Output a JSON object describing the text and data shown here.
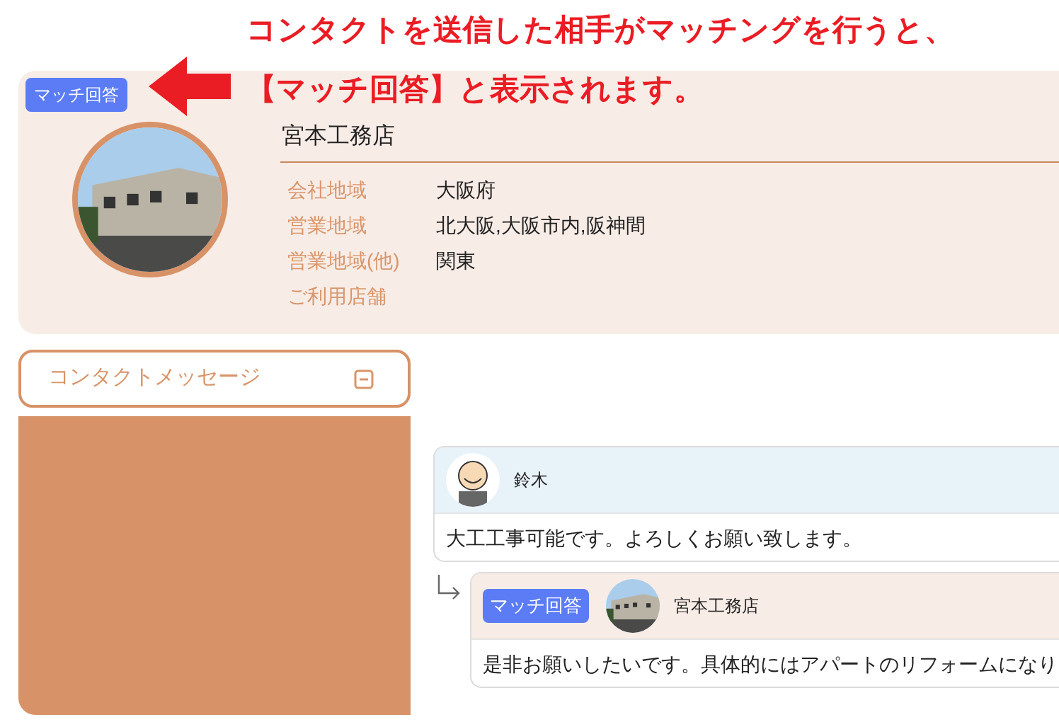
{
  "annotation": {
    "lines": [
      "コンタクトを送信した相手がマッチングを行うと、",
      "【マッチ回答】と表示されます。"
    ]
  },
  "profile": {
    "badge": "マッチ回答",
    "name": "宮本工務店",
    "fields": [
      {
        "label": "会社地域",
        "value": "大阪府"
      },
      {
        "label": "営業地域",
        "value": "北大阪,大阪市内,阪神間"
      },
      {
        "label": "営業地域(他)",
        "value": "関東"
      },
      {
        "label": "ご利用店舗"
      }
    ]
  },
  "contact_button": {
    "label": "コンタクトメッセージ"
  },
  "messages": [
    {
      "kind": "message",
      "sender": "鈴木",
      "text": "大工工事可能です。よろしくお願い致します。"
    },
    {
      "kind": "reply",
      "badge": "マッチ回答",
      "sender": "宮本工務店",
      "text": "是非お願いしたいです。具体的にはアパートのリフォームになり"
    }
  ]
}
